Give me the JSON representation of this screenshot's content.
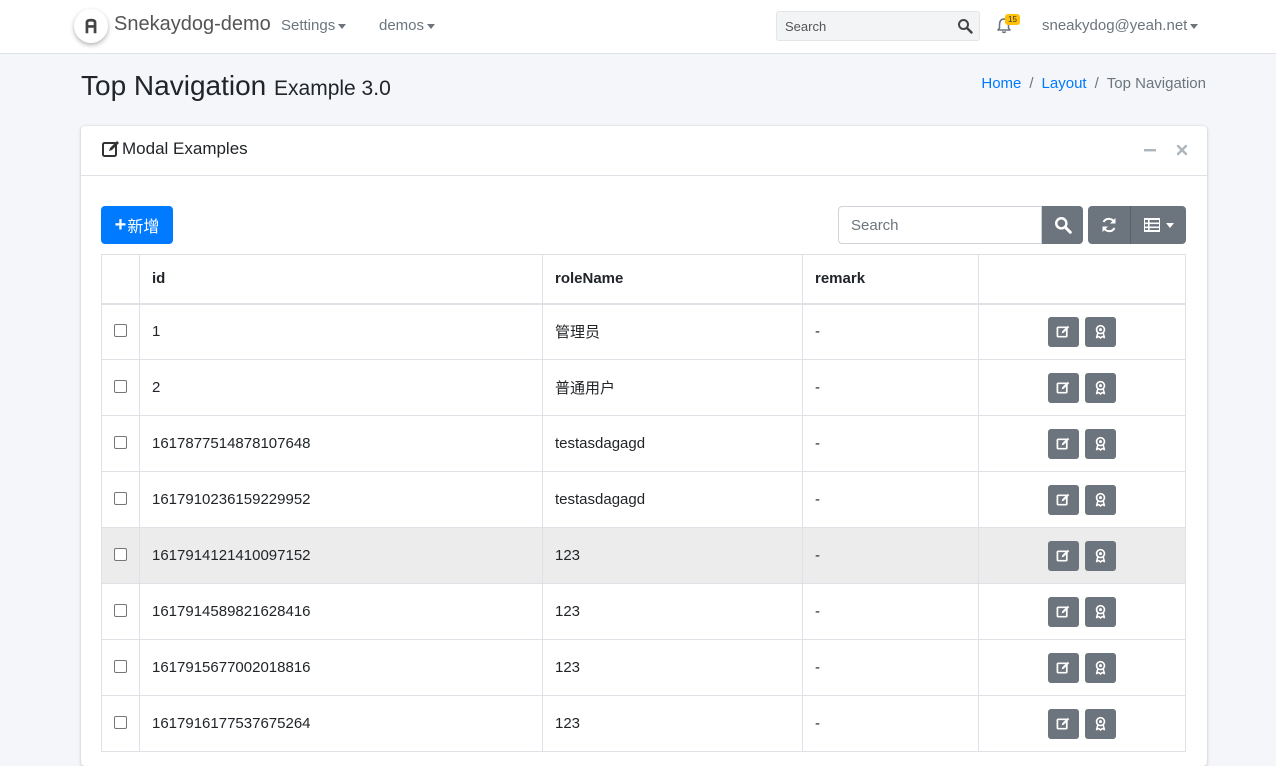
{
  "navbar": {
    "brand": "Snekaydog-demo",
    "menus": [
      {
        "label": "Settings"
      },
      {
        "label": "demos"
      }
    ],
    "search_placeholder": "Search",
    "notification_count": "15",
    "user": "sneakydog@yeah.net"
  },
  "header": {
    "title": "Top Navigation",
    "subtitle": "Example 3.0",
    "breadcrumb": [
      "Home",
      "Layout",
      "Top Navigation"
    ]
  },
  "card": {
    "title": "Modal Examples",
    "add_button": "新增",
    "search_placeholder": "Search",
    "columns": [
      "id",
      "roleName",
      "remark"
    ],
    "rows": [
      {
        "id": "1",
        "roleName": "管理员",
        "remark": "-"
      },
      {
        "id": "2",
        "roleName": "普通用户",
        "remark": "-"
      },
      {
        "id": "1617877514878107648",
        "roleName": "testasdagagd",
        "remark": "-"
      },
      {
        "id": "1617910236159229952",
        "roleName": "testasdagagd",
        "remark": "-"
      },
      {
        "id": "1617914121410097152",
        "roleName": "123",
        "remark": "-"
      },
      {
        "id": "1617914589821628416",
        "roleName": "123",
        "remark": "-"
      },
      {
        "id": "1617915677002018816",
        "roleName": "123",
        "remark": "-"
      },
      {
        "id": "1617916177537675264",
        "roleName": "123",
        "remark": "-"
      }
    ],
    "hovered_row_index": 4
  },
  "icons": {
    "brand": "brand-logo-icon",
    "search": "search-icon",
    "notification": "bell-icon",
    "edit": "edit-icon",
    "award": "award-icon",
    "refresh": "refresh-icon",
    "columns": "list-icon",
    "minimize": "minus-icon",
    "close": "close-icon"
  },
  "colors": {
    "primary": "#007bff",
    "secondary": "#6c757d",
    "badge": "#ffc107",
    "background": "#f4f6f9"
  }
}
